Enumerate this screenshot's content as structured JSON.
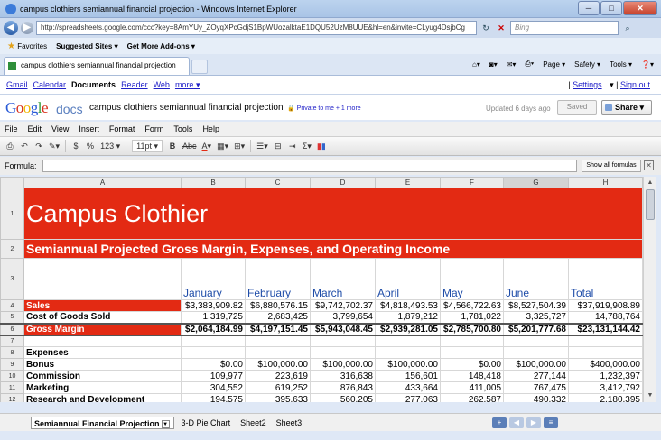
{
  "browser": {
    "window_title": "campus clothiers semiannual financial projection - Windows Internet Explorer",
    "address": "http://spreadsheets.google.com/ccc?key=8AmYUy_ZOyqXPcGdjS1BpWUozalktaE1DQU52UzM8UUE&hl=en&invite=CLyug4DsjbCg",
    "search_placeholder": "Bing",
    "favorites_label": "Favorites",
    "suggested_sites": "Suggested Sites",
    "addons": "Get More Add-ons",
    "tab_title": "campus clothiers semiannual financial projection",
    "cmd": {
      "page": "Page",
      "safety": "Safety",
      "tools": "Tools"
    }
  },
  "gbar": {
    "links": [
      "Gmail",
      "Calendar",
      "Documents",
      "Reader",
      "Web",
      "more"
    ],
    "current": "Documents",
    "settings": "Settings",
    "signout": "Sign out"
  },
  "docs": {
    "logo": "Google",
    "product": "docs",
    "title": "campus clothiers semiannual financial projection",
    "privacy": "Private to me + 1 more",
    "updated": "Updated 6 days ago",
    "saved": "Saved",
    "share": "Share"
  },
  "menu": [
    "File",
    "Edit",
    "View",
    "Insert",
    "Format",
    "Form",
    "Tools",
    "Help"
  ],
  "toolbar": {
    "currency": "$",
    "percent": "%",
    "number_format": "123",
    "font_size": "11pt",
    "bold": "B",
    "strike": "Abc",
    "sigma": "Σ"
  },
  "formula": {
    "label": "Formula:",
    "show_all": "Show all formulas",
    "close": "✕"
  },
  "columns": [
    "A",
    "B",
    "C",
    "D",
    "E",
    "F",
    "G",
    "H"
  ],
  "rows": [
    1,
    2,
    3,
    4,
    5,
    6,
    7,
    8,
    9,
    10,
    11,
    12
  ],
  "sheet": {
    "title": "Campus Clothier",
    "subtitle": "Semiannual Projected Gross Margin, Expenses, and Operating Income",
    "months": [
      "January",
      "February",
      "March",
      "April",
      "May",
      "June",
      "Total"
    ],
    "sales": {
      "label": "Sales",
      "values": [
        "$3,383,909.82",
        "$6,880,576.15",
        "$9,742,702.37",
        "$4,818,493.53",
        "$4,566,722.63",
        "$8,527,504.39",
        "$37,919,908.89"
      ]
    },
    "cogs": {
      "label": "Cost of Goods Sold",
      "values": [
        "1,319,725",
        "2,683,425",
        "3,799,654",
        "1,879,212",
        "1,781,022",
        "3,325,727",
        "14,788,764"
      ]
    },
    "gross": {
      "label": "Gross Margin",
      "values": [
        "$2,064,184.99",
        "$4,197,151.45",
        "$5,943,048.45",
        "$2,939,281.05",
        "$2,785,700.80",
        "$5,201,777.68",
        "$23,131,144.42"
      ]
    },
    "expenses_label": "Expenses",
    "bonus": {
      "label": "Bonus",
      "values": [
        "$0.00",
        "$100,000.00",
        "$100,000.00",
        "$100,000.00",
        "$0.00",
        "$100,000.00",
        "$400,000.00"
      ]
    },
    "commission": {
      "label": "Commission",
      "values": [
        "109,977",
        "223,619",
        "316,638",
        "156,601",
        "148,418",
        "277,144",
        "1,232,397"
      ]
    },
    "marketing": {
      "label": "Marketing",
      "values": [
        "304,552",
        "619,252",
        "876,843",
        "433,664",
        "411,005",
        "767,475",
        "3,412,792"
      ]
    },
    "research": {
      "label": "Research and Development",
      "values": [
        "194,575",
        "395,633",
        "560,205",
        "277,063",
        "262,587",
        "490,332",
        "2,180,395"
      ]
    }
  },
  "tabs": [
    "Semiannual Financial Projection",
    "3-D Pie Chart",
    "Sheet2",
    "Sheet3"
  ]
}
